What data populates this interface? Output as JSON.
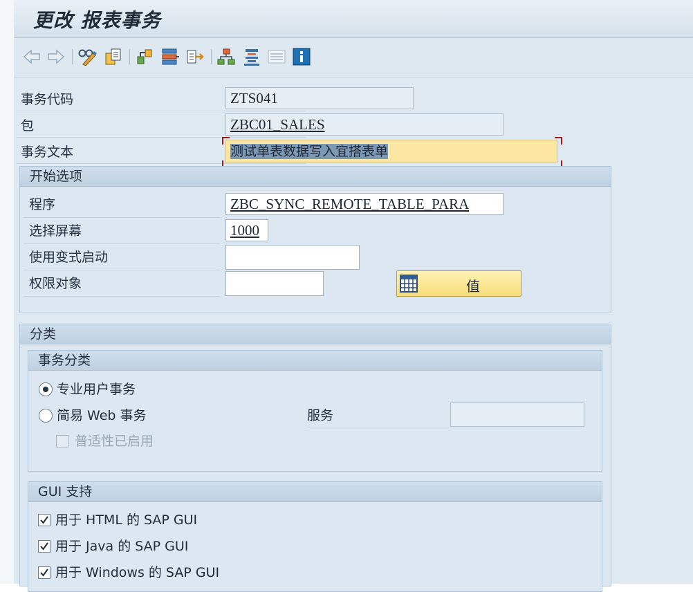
{
  "title": "更改 报表事务",
  "toolbar": {
    "items": [
      "back-arrow-icon",
      "forward-arrow-icon",
      "display-change-icon",
      "copy-object-icon",
      "other-object-icon",
      "where-used-icon",
      "transport-icon",
      "hierarchy-icon",
      "align-icon",
      "list-icon",
      "info-icon"
    ]
  },
  "header_fields": {
    "tcode_label": "事务代码",
    "tcode_value": "ZTS041",
    "package_label": "包",
    "package_value": "ZBC01_SALES",
    "text_label": "事务文本",
    "text_value": "测试单表数据写入宜搭表单"
  },
  "start_options": {
    "heading": "开始选项",
    "program_label": "程序",
    "program_value": "ZBC_SYNC_REMOTE_TABLE_PARA",
    "screen_label": "选择屏幕",
    "screen_value": "1000",
    "variant_label": "使用变式启动",
    "variant_value": "",
    "auth_label": "权限对象",
    "auth_value": "",
    "values_button": "值"
  },
  "classification": {
    "heading": "分类",
    "tx_class": {
      "heading": "事务分类",
      "option_professional": "专业用户事务",
      "option_easy_web": "简易 Web 事务",
      "selected": "专业用户事务",
      "service_label": "服务",
      "service_value": "",
      "pervasive_label": "普适性已启用",
      "pervasive_checked": false,
      "pervasive_enabled": false
    },
    "gui_support": {
      "heading": "GUI 支持",
      "options": [
        {
          "label": "用于 HTML 的 SAP GUI",
          "checked": true
        },
        {
          "label": "用于 Java 的 SAP GUI",
          "checked": true
        },
        {
          "label": "用于 Windows 的 SAP GUI",
          "checked": true
        }
      ]
    }
  },
  "colors": {
    "focus_field": "#fbe7a2",
    "button": "#f8dd7a",
    "panel": "#dfe9f2",
    "selection": "#7d99b6"
  }
}
